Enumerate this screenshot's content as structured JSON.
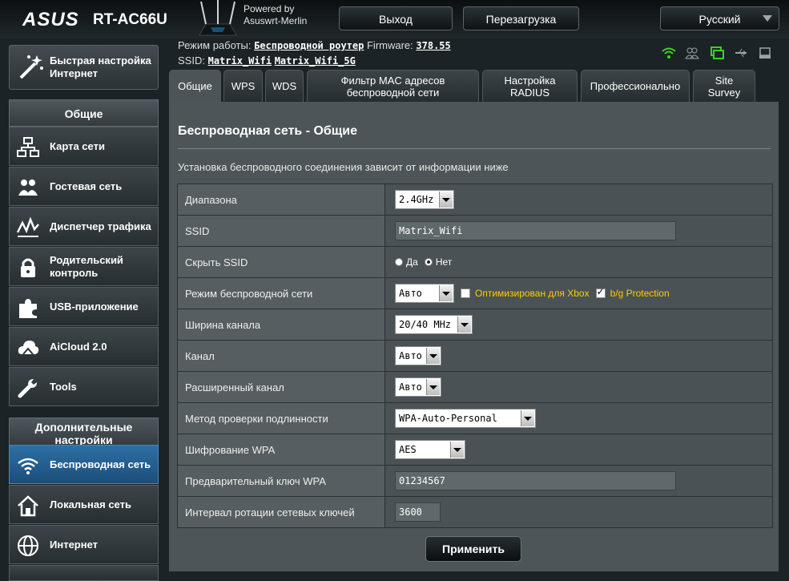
{
  "header": {
    "brand": "ASUS",
    "model": "RT-AC66U",
    "powered_by": "Powered by",
    "firmware_name": "Asuswrt-Merlin",
    "logout_label": "Выход",
    "reboot_label": "Перезагрузка",
    "language": "Русский"
  },
  "info": {
    "mode_label": "Режим работы:",
    "mode_value": "Беспроводной роутер",
    "firmware_label": "Firmware:",
    "firmware_value": "378.55",
    "ssid_label": "SSID:",
    "ssid_1": "Matrix_Wifi",
    "ssid_2": "Matrix_Wifi_5G"
  },
  "sidebar": {
    "quick_setup": "Быстрая настройка Интернет",
    "general_header": "Общие",
    "items": [
      {
        "label": "Карта сети",
        "icon": "network-map-icon"
      },
      {
        "label": "Гостевая сеть",
        "icon": "guest-network-icon"
      },
      {
        "label": "Диспетчер трафика",
        "icon": "traffic-manager-icon"
      },
      {
        "label": "Родительский контроль",
        "icon": "parental-lock-icon"
      },
      {
        "label": "USB-приложение",
        "icon": "puzzle-icon"
      },
      {
        "label": "AiCloud 2.0",
        "icon": "cloud-icon"
      },
      {
        "label": "Tools",
        "icon": "wrench-icon"
      }
    ],
    "advanced_header": "Дополнительные настройки",
    "advanced_items": [
      {
        "label": "Беспроводная сеть",
        "icon": "wifi-icon"
      },
      {
        "label": "Локальная сеть",
        "icon": "home-icon"
      },
      {
        "label": "Интернет",
        "icon": "globe-icon"
      }
    ]
  },
  "tabs": [
    {
      "label": "Общие"
    },
    {
      "label": "WPS"
    },
    {
      "label": "WDS"
    },
    {
      "label": "Фильтр MAC адресов беспроводной сети"
    },
    {
      "label": "Настройка RADIUS"
    },
    {
      "label": "Профессионально"
    },
    {
      "label": "Site Survey"
    }
  ],
  "content": {
    "title": "Беспроводная сеть - Общие",
    "description": "Установка беспроводного соединения зависит от информации ниже",
    "apply_label": "Применить"
  },
  "form": {
    "band_label": "Диапазона",
    "band_value": "2.4GHz",
    "ssid_label": "SSID",
    "ssid_value": "Matrix_Wifi",
    "hide_label": "Скрыть SSID",
    "hide_yes": "Да",
    "hide_no": "Нет",
    "mode_label": "Режим беспроводной сети",
    "mode_value": "Авто",
    "xbox_label": "Оптимизирован для Xbox",
    "bg_label": "b/g Protection",
    "width_label": "Ширина канала",
    "width_value": "20/40 MHz",
    "channel_label": "Канал",
    "channel_value": "Авто",
    "ext_label": "Расширенный канал",
    "ext_value": "Авто",
    "auth_label": "Метод проверки подлинности",
    "auth_value": "WPA-Auto-Personal",
    "enc_label": "Шифрование WPA",
    "enc_value": "AES",
    "psk_label": "Предварительный ключ WPA",
    "psk_value": "01234567",
    "rekey_label": "Интервал ротации сетевых ключей",
    "rekey_value": "3600"
  },
  "colors": {
    "accent_yellow": "#ffcc00",
    "status_green": "#39d21f"
  }
}
